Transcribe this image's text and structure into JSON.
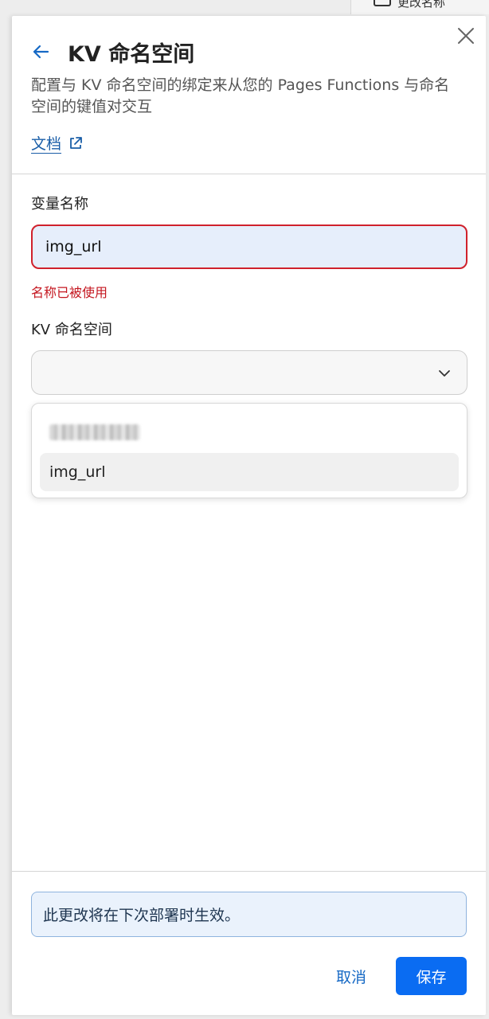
{
  "backdrop": {
    "top_right_text": "更改名称"
  },
  "panel": {
    "title": "KV 命名空间",
    "description": "配置与 KV 命名空间的绑定来从您的 Pages Functions 与命名空间的键值对交互",
    "docs_link": "文档"
  },
  "form": {
    "variable_label": "变量名称",
    "variable_value": "img_url",
    "error_text": "名称已被使用",
    "namespace_label": "KV 命名空间",
    "namespace_selected": "",
    "dropdown_options": [
      {
        "label": "[redacted]",
        "blurred": true
      },
      {
        "label": "img_url",
        "blurred": false
      }
    ]
  },
  "footer": {
    "notice": "此更改将在下次部署时生效。",
    "cancel_label": "取消",
    "save_label": "保存"
  },
  "colors": {
    "accent": "#0a6cf2",
    "error": "#c4161f",
    "link": "#1a5ea8",
    "notice_bg": "#eaf2fc"
  }
}
